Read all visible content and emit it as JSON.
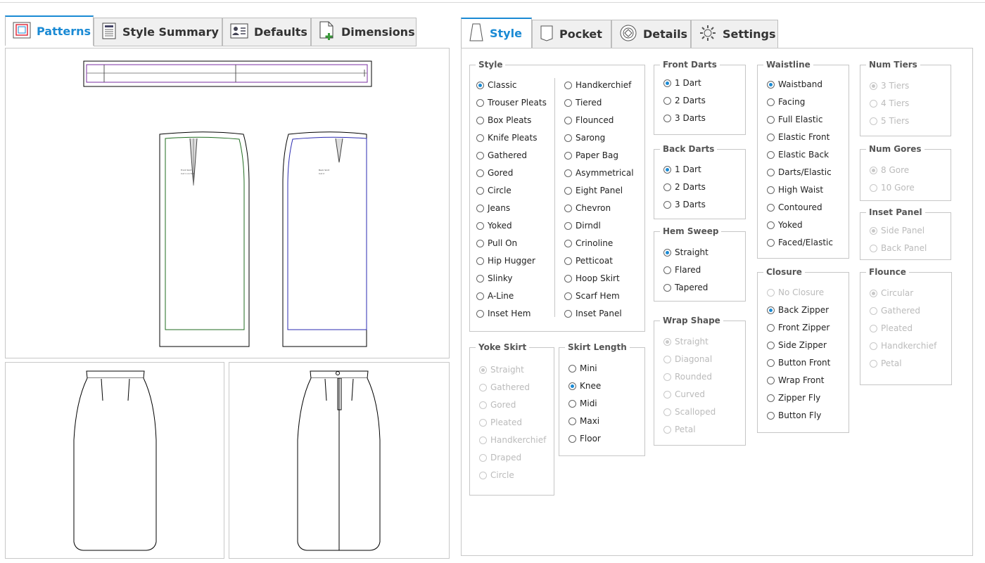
{
  "left_tabs": [
    {
      "label": "Patterns",
      "icon": "patterns-icon",
      "active": true
    },
    {
      "label": "Style Summary",
      "icon": "document-icon",
      "active": false
    },
    {
      "label": "Defaults",
      "icon": "contact-card-icon",
      "active": false
    },
    {
      "label": "Dimensions",
      "icon": "add-document-icon",
      "active": false
    }
  ],
  "right_tabs": [
    {
      "label": "Style",
      "icon": "skirt-icon",
      "active": true
    },
    {
      "label": "Pocket",
      "icon": "pocket-icon",
      "active": false
    },
    {
      "label": "Details",
      "icon": "target-icon",
      "active": false
    },
    {
      "label": "Settings",
      "icon": "gear-icon",
      "active": false
    }
  ],
  "accent_color": "#1a8ad4",
  "groups": {
    "style": {
      "title": "Style",
      "col1": [
        "Classic",
        "Trouser Pleats",
        "Box Pleats",
        "Knife Pleats",
        "Gathered",
        "Gored",
        "Circle",
        "Jeans",
        "Yoked",
        "Pull On",
        "Hip Hugger",
        "Slinky",
        "A-Line",
        "Inset Hem"
      ],
      "col2": [
        "Handkerchief",
        "Tiered",
        "Flounced",
        "Sarong",
        "Paper Bag",
        "Asymmetrical",
        "Eight Panel",
        "Chevron",
        "Dirndl",
        "Crinoline",
        "Petticoat",
        "Hoop Skirt",
        "Scarf Hem",
        "Inset Panel"
      ],
      "selected": "Classic"
    },
    "front_darts": {
      "title": "Front Darts",
      "options": [
        "1 Dart",
        "2 Darts",
        "3 Darts"
      ],
      "selected": "1 Dart"
    },
    "back_darts": {
      "title": "Back Darts",
      "options": [
        "1 Dart",
        "2 Darts",
        "3 Darts"
      ],
      "selected": "1 Dart"
    },
    "hem_sweep": {
      "title": "Hem Sweep",
      "options": [
        "Straight",
        "Flared",
        "Tapered"
      ],
      "selected": "Straight"
    },
    "wrap_shape": {
      "title": "Wrap Shape",
      "options": [
        "Straight",
        "Diagonal",
        "Rounded",
        "Curved",
        "Scalloped",
        "Petal"
      ],
      "selected": "Straight",
      "disabled": true
    },
    "waistline": {
      "title": "Waistline",
      "options": [
        "Waistband",
        "Facing",
        "Full Elastic",
        "Elastic Front",
        "Elastic Back",
        "Darts/Elastic",
        "High Waist",
        "Contoured",
        "Yoked",
        "Faced/Elastic"
      ],
      "selected": "Waistband"
    },
    "closure": {
      "title": "Closure",
      "options": [
        "No Closure",
        "Back Zipper",
        "Front Zipper",
        "Side Zipper",
        "Button Front",
        "Wrap Front",
        "Zipper Fly",
        "Button Fly"
      ],
      "selected": "Back Zipper",
      "disabled_options": [
        "No Closure"
      ]
    },
    "num_tiers": {
      "title": "Num Tiers",
      "options": [
        "3 Tiers",
        "4 Tiers",
        "5 Tiers"
      ],
      "selected": "3 Tiers",
      "disabled": true
    },
    "num_gores": {
      "title": "Num Gores",
      "options": [
        "8 Gore",
        "10 Gore"
      ],
      "selected": "8 Gore",
      "disabled": true
    },
    "inset_panel": {
      "title": "Inset Panel",
      "options": [
        "Side Panel",
        "Back Panel"
      ],
      "selected": "Side Panel",
      "disabled": true
    },
    "flounce": {
      "title": "Flounce",
      "options": [
        "Circular",
        "Gathered",
        "Pleated",
        "Handkerchief",
        "Petal"
      ],
      "selected": "Circular",
      "disabled": true
    },
    "yoke_skirt": {
      "title": "Yoke Skirt",
      "options": [
        "Straight",
        "Gathered",
        "Gored",
        "Pleated",
        "Handkerchief",
        "Draped",
        "Circle"
      ],
      "selected": "Straight",
      "disabled": true
    },
    "skirt_length": {
      "title": "Skirt Length",
      "options": [
        "Mini",
        "Knee",
        "Midi",
        "Maxi",
        "Floor"
      ],
      "selected": "Knee"
    }
  }
}
